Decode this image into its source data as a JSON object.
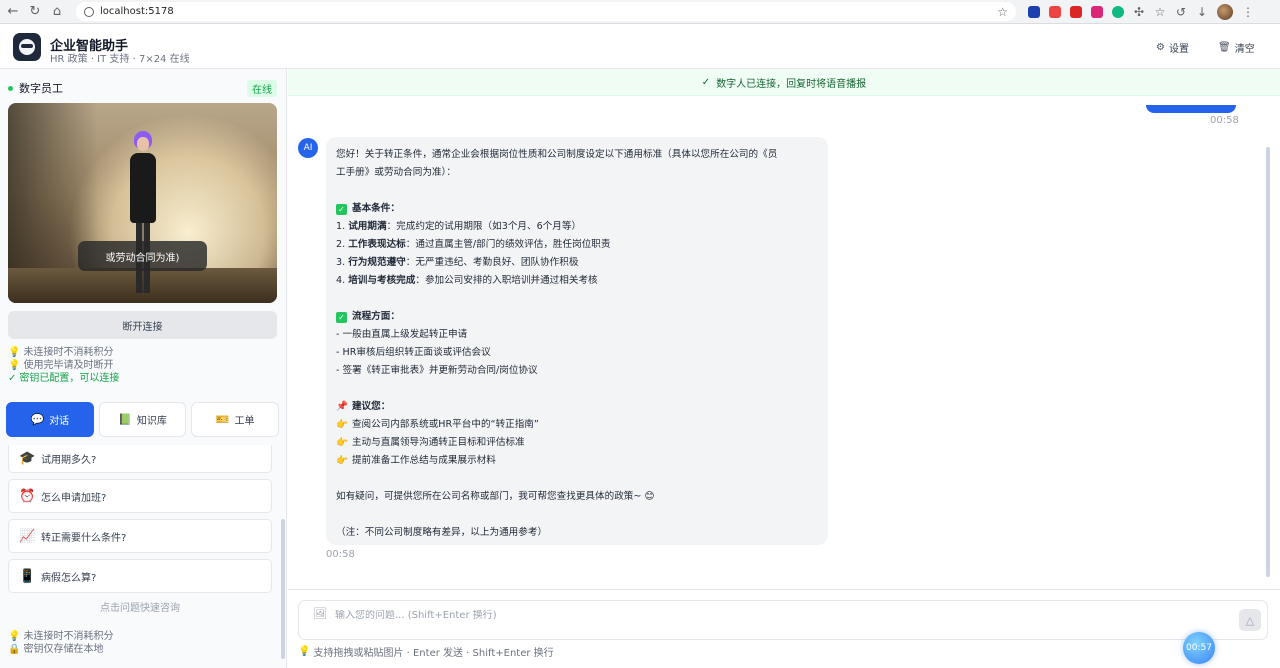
{
  "browser": {
    "url": "localhost:5178"
  },
  "header": {
    "title": "企业智能助手",
    "subtitle": "HR 政策 · IT 支持 · 7×24 在线",
    "settings_label": "设置",
    "clear_label": "清空"
  },
  "sidebar": {
    "title": "数字员工",
    "status": "在线",
    "avatar_subtitle": "或劳动合同为准)",
    "disconnect_label": "断开连接",
    "tips": [
      "未连接时不消耗积分",
      "使用完毕请及时断开",
      "密钥已配置，可以连接"
    ],
    "tabs": [
      {
        "label": "对话",
        "icon": "chat-icon"
      },
      {
        "label": "知识库",
        "icon": "book-icon"
      },
      {
        "label": "工单",
        "icon": "ticket-icon"
      }
    ],
    "quick_questions": [
      {
        "label": "试用期多久?",
        "icon": "graduation-cap-icon"
      },
      {
        "label": "怎么申请加班?",
        "icon": "alarm-clock-icon"
      },
      {
        "label": "转正需要什么条件?",
        "icon": "chart-up-icon"
      },
      {
        "label": "病假怎么算?",
        "icon": "phone-calendar-icon"
      }
    ],
    "quick_hint": "点击问题快速咨询",
    "footer_tips": [
      "未连接时不消耗积分",
      "密钥仅存储在本地"
    ]
  },
  "main": {
    "banner": "数字人已连接，回复时将语音播报",
    "user_message_time": "00:58",
    "ai_message": {
      "intro_line1": "您好！关于转正条件，通常企业会根据岗位性质和公司制度设定以下通用标准（具体以您所在公司的《员",
      "intro_line2": "工手册》或劳动合同为准）：",
      "basic_title": "基本条件：",
      "basic_items": [
        {
          "num": "1.",
          "term": "试用期满",
          "desc": "：完成约定的试用期限（如3个月、6个月等）"
        },
        {
          "num": "2.",
          "term": "工作表现达标",
          "desc": "：通过直属主管/部门的绩效评估，胜任岗位职责"
        },
        {
          "num": "3.",
          "term": "行为规范遵守",
          "desc": "：无严重违纪、考勤良好、团队协作积极"
        },
        {
          "num": "4.",
          "term": "培训与考核完成",
          "desc": "：参加公司安排的入职培训并通过相关考核"
        }
      ],
      "process_title": "流程方面：",
      "process_items": [
        "- 一般由直属上级发起转正申请",
        "- HR审核后组织转正面谈或评估会议",
        "- 签署《转正审批表》并更新劳动合同/岗位协议"
      ],
      "advice_title": "建议您：",
      "advice_items": [
        "查阅公司内部系统或HR平台中的“转正指南”",
        "主动与直属领导沟通转正目标和评估标准",
        "提前准备工作总结与成果展示材料"
      ],
      "closing": "如有疑问，可提供您所在公司名称或部门，我可帮您查找更具体的政策~ 😊",
      "note": "（注：不同公司制度略有差异，以上为通用参考）",
      "time": "00:58"
    },
    "input": {
      "placeholder": "输入您的问题... (Shift+Enter 换行)",
      "hint": "支持拖拽或粘贴图片 · Enter 发送 · Shift+Enter 换行"
    },
    "timer": "00:57"
  },
  "colors": {
    "accent": "#2563eb",
    "online": "#22c55e",
    "banner_bg": "#f0fdf4"
  }
}
